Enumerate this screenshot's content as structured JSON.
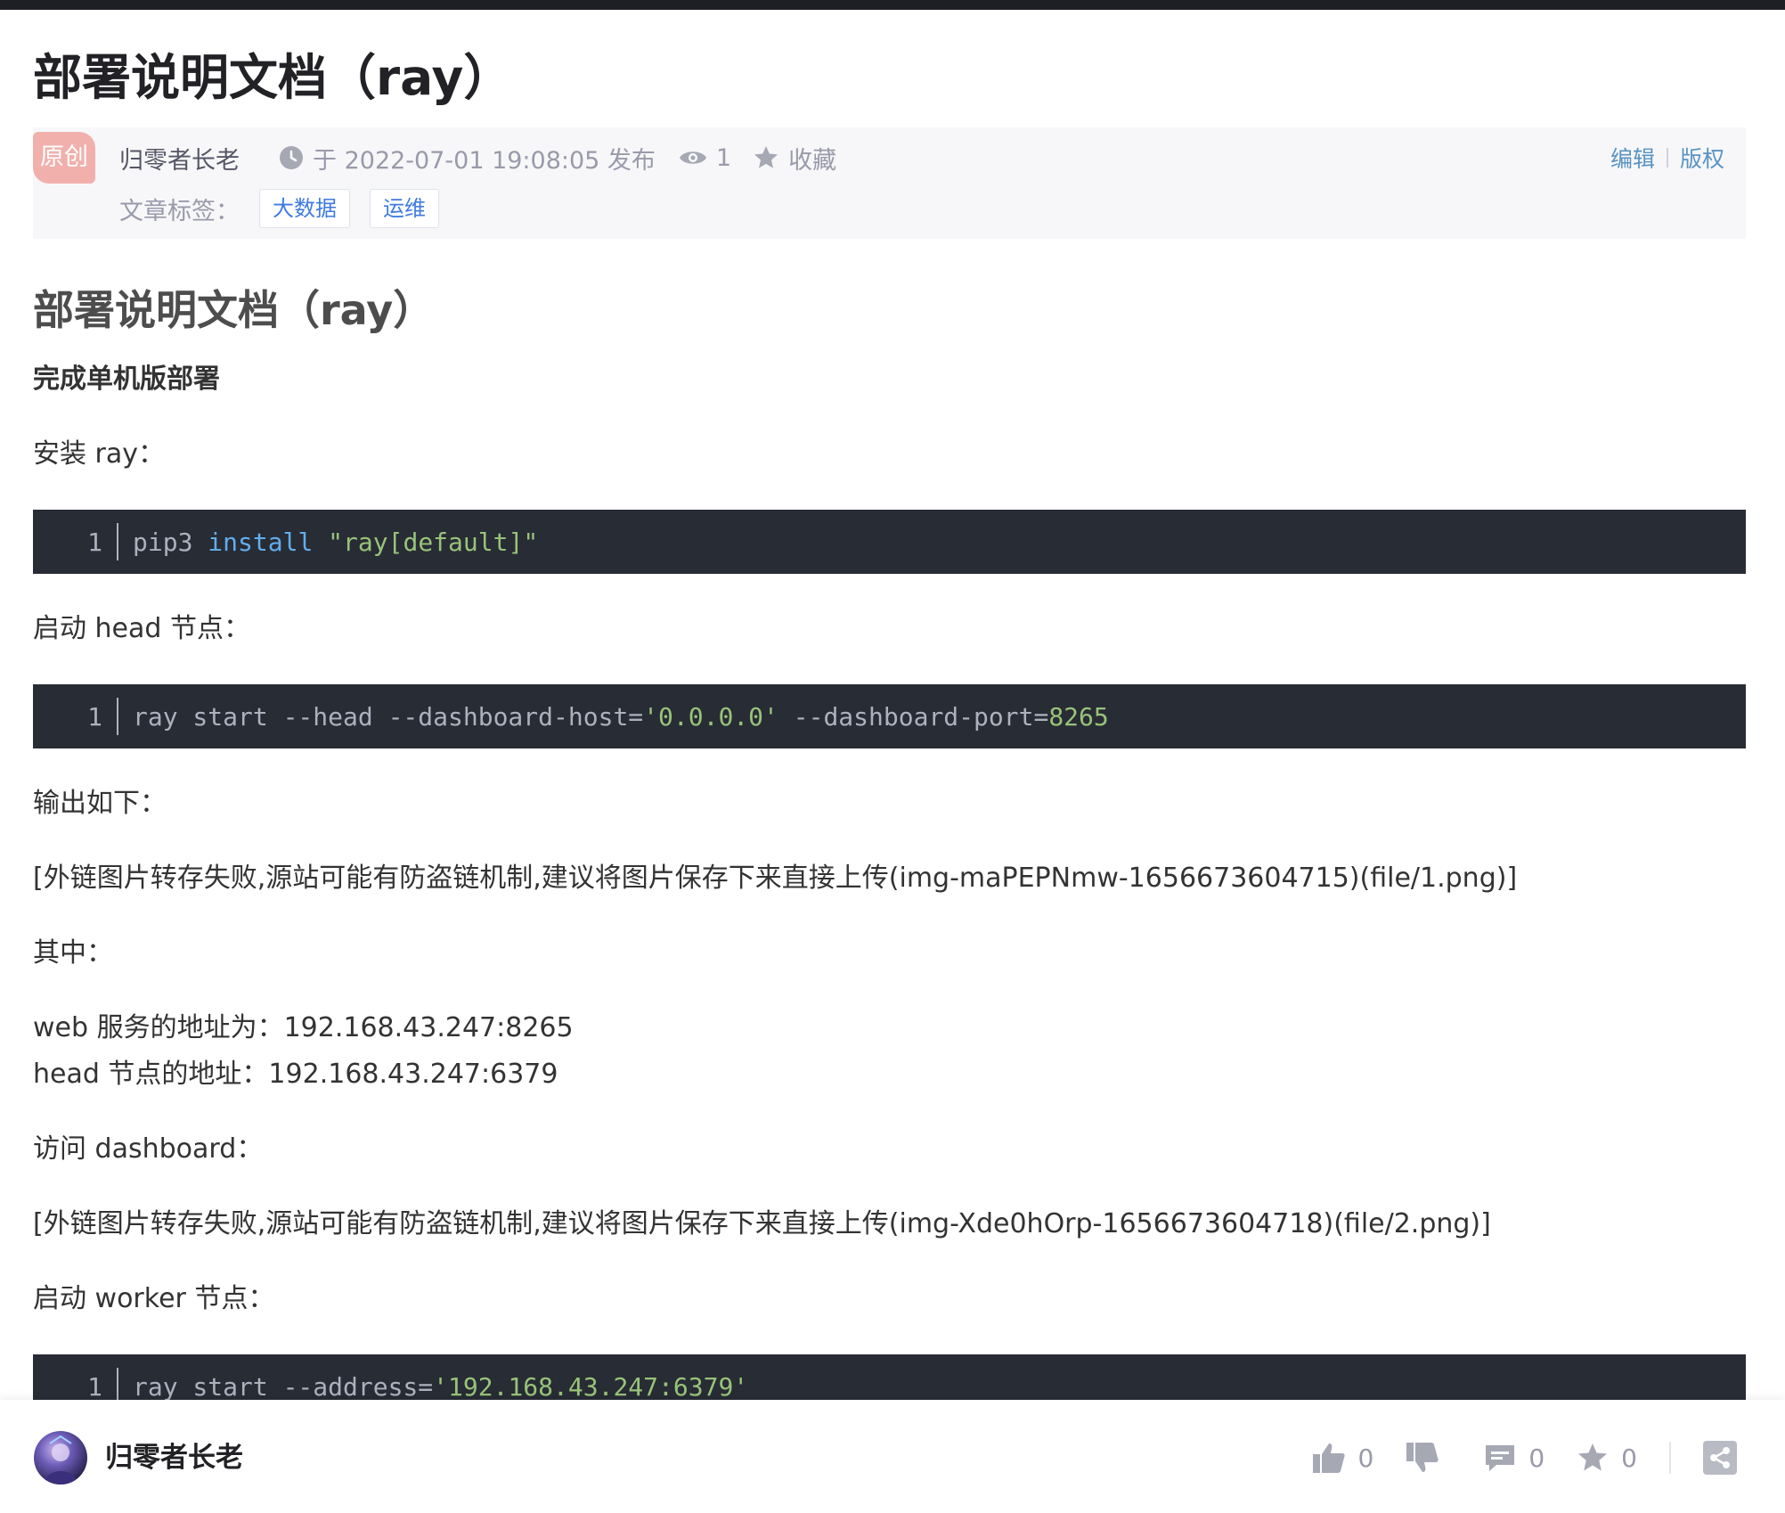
{
  "article": {
    "title": "部署说明文档（ray）",
    "badge": "原创",
    "author": "归零者长老",
    "published": "于 2022-07-01 19:08:05 发布",
    "views": "1",
    "favorite_label": "收藏",
    "edit_label": "编辑",
    "copyright_label": "版权",
    "tags_label": "文章标签：",
    "tags": [
      "大数据",
      "运维"
    ]
  },
  "content": {
    "heading": "部署说明文档（ray）",
    "subheading": "完成单机版部署",
    "install_label": "安装 ray：",
    "code1": {
      "line": "1",
      "t1": "pip3 ",
      "t2": "install",
      "t3": " ",
      "t4": "\"ray[default]\""
    },
    "start_head_label": "启动 head 节点：",
    "code2": {
      "line": "1",
      "t1": "ray start --head --dashboard-host=",
      "t2": "'0.0.0.0'",
      "t3": " --dashboard-port=",
      "t4": "8265"
    },
    "output_label": "输出如下：",
    "img1": "[外链图片转存失败,源站可能有防盗链机制,建议将图片保存下来直接上传(img-maPEPNmw-1656673604715)(file/1.png)]",
    "among_label": "其中：",
    "web_addr": "web 服务的地址为：192.168.43.247:8265",
    "head_addr": "head 节点的地址：192.168.43.247:6379",
    "visit_label": "访问 dashboard：",
    "img2": "[外链图片转存失败,源站可能有防盗链机制,建议将图片保存下来直接上传(img-Xde0hOrp-1656673604718)(file/2.png)]",
    "start_worker_label": "启动 worker 节点：",
    "code3": {
      "line": "1",
      "t1": "ray start --address=",
      "t2": "'192.168.43.247:6379'"
    }
  },
  "bottom": {
    "author": "归零者长老",
    "likes": "0",
    "comments": "0",
    "favorites": "0"
  },
  "colors": {
    "badge": "#f1b0ac",
    "link": "#5893c2",
    "tag": "#3e7ae2",
    "code_bg": "#282c34",
    "code_string": "#98c379",
    "code_keyword": "#61aeee"
  },
  "icons": [
    "clock-icon",
    "eye-icon",
    "star-icon",
    "thumb-up-icon",
    "thumb-down-icon",
    "comment-icon",
    "share-icon"
  ]
}
